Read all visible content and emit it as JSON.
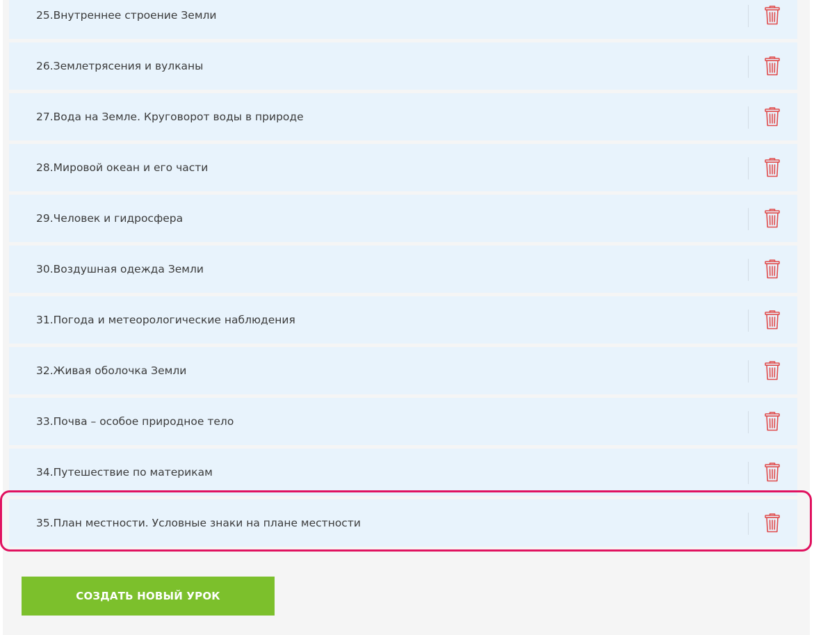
{
  "lessons": [
    {
      "number": "25.",
      "title": "Внутреннее строение Земли"
    },
    {
      "number": "26.",
      "title": "Землетрясения и вулканы"
    },
    {
      "number": "27.",
      "title": "Вода на Земле. Круговорот воды в природе"
    },
    {
      "number": "28.",
      "title": "Мировой океан и его части"
    },
    {
      "number": "29.",
      "title": "Человек и гидросфера"
    },
    {
      "number": "30.",
      "title": "Воздушная одежда Земли"
    },
    {
      "number": "31.",
      "title": "Погода и метеорологические наблюдения"
    },
    {
      "number": "32.",
      "title": "Живая оболочка Земли"
    },
    {
      "number": "33.",
      "title": "Почва – особое природное тело"
    },
    {
      "number": "34.",
      "title": "Путешествие по материкам"
    },
    {
      "number": "35.",
      "title": "План местности. Условные знаки на плане местности"
    }
  ],
  "delete_icon": "trash-icon",
  "create_button": {
    "label": "СОЗДАТЬ НОВЫЙ УРОК"
  },
  "colors": {
    "row_background": "#e8f3fc",
    "delete_icon": "#e04a4a",
    "highlight_border": "#e0125f",
    "create_button": "#7cc02c",
    "panel_background": "#f5f5f5"
  }
}
